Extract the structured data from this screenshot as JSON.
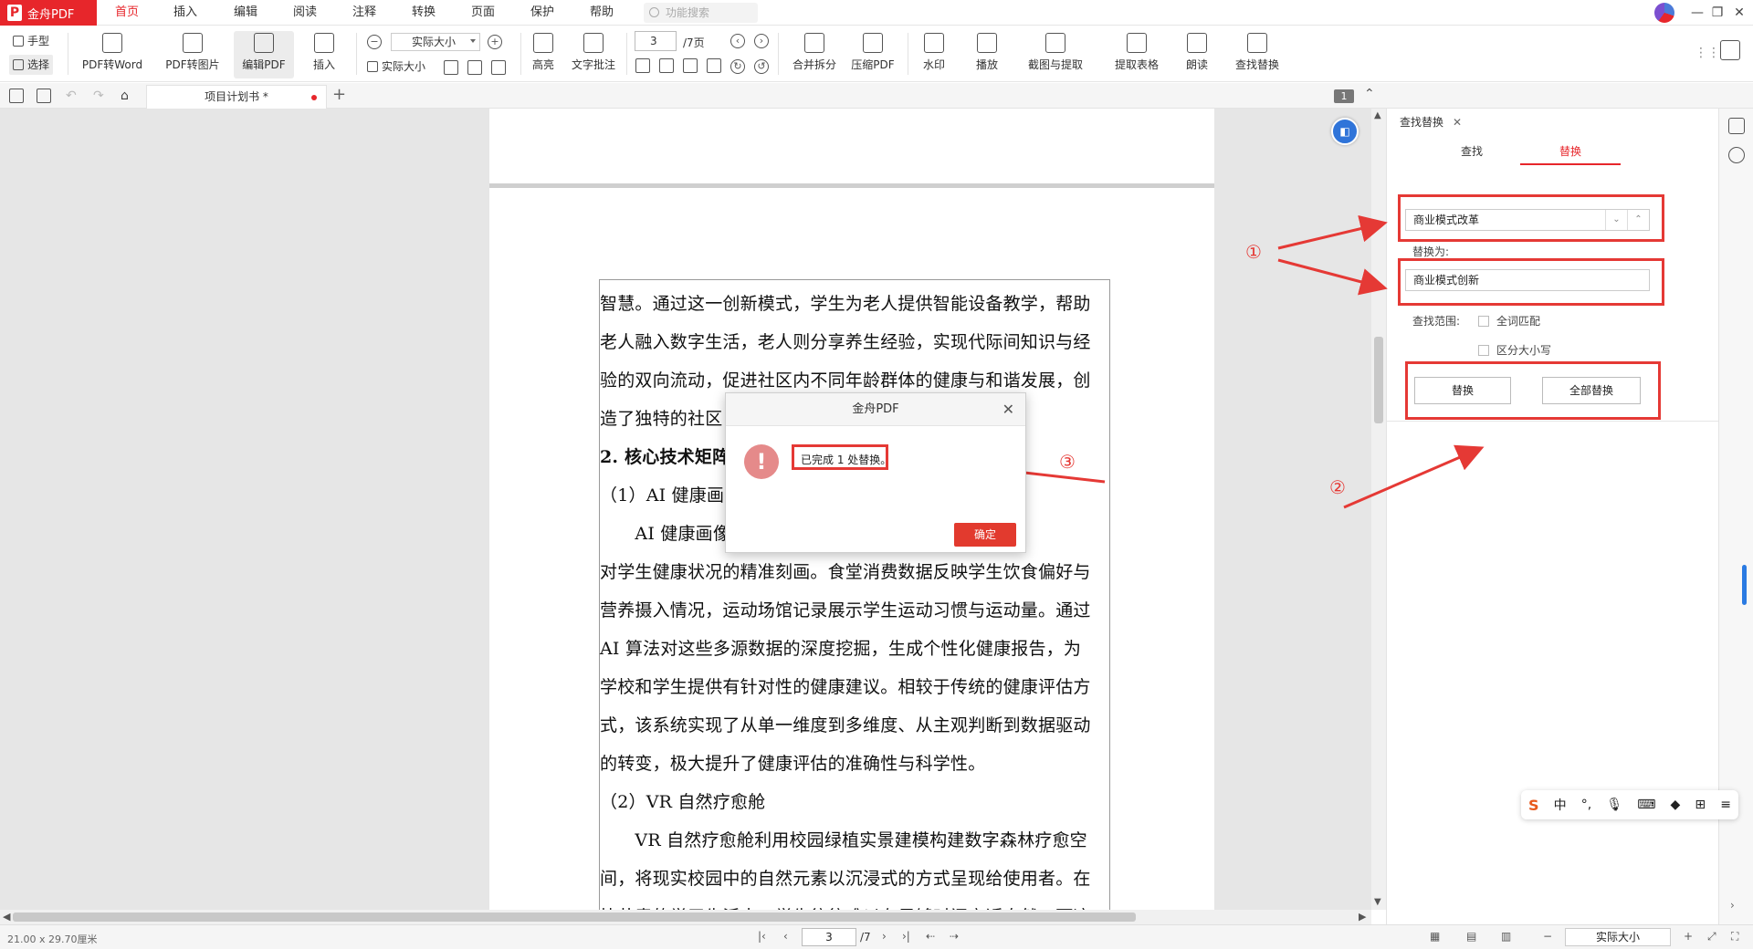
{
  "app": {
    "name": "金舟PDF",
    "menus": [
      "首页",
      "插入",
      "编辑",
      "阅读",
      "注释",
      "转换",
      "页面",
      "保护",
      "帮助"
    ],
    "active_menu": "首页",
    "search_placeholder": "功能搜索"
  },
  "ribbon": {
    "hand": "手型",
    "select": "选择",
    "pdf_to_word": "PDF转Word",
    "pdf_to_image": "PDF转图片",
    "edit_pdf": "编辑PDF",
    "insert": "插入",
    "zoom_value": "实际大小",
    "actual_size": "实际大小",
    "highlight": "高亮",
    "text_note": "文字批注",
    "page_current": "3",
    "page_total": "/7页",
    "merge_split": "合并拆分",
    "compress": "压缩PDF",
    "watermark": "水印",
    "play": "播放",
    "screenshot_extract": "截图与提取",
    "extract_table": "提取表格",
    "read_aloud": "朗读",
    "find_replace": "查找替换"
  },
  "tabs": {
    "doc_name": "项目计划书 *",
    "page_badge": "1"
  },
  "document": {
    "lines": [
      "智慧。通过这一创新模式，学生为老人提供智能设备教学，帮助",
      "老人融入数字生活，老人则分享养生经验，实现代际间知识与经",
      "验的双向流动，促进社区内不同年龄群体的健康与和谐发展，创",
      "造了独特的社区",
      "2. 核心技术矩阵",
      "（1）AI 健康画",
      "　　AI 健康画像                                                ，实现了",
      "对学生健康状况的精准刻画。食堂消费数据反映学生饮食偏好与",
      "营养摄入情况，运动场馆记录展示学生运动习惯与运动量。通过",
      "AI 算法对这些多源数据的深度挖掘，生成个性化健康报告，为",
      "学校和学生提供有针对性的健康建议。相较于传统的健康评估方",
      "式，该系统实现了从单一维度到多维度、从主观判断到数据驱动",
      "的转变，极大提升了健康评估的准确性与科学性。",
      "（2）VR 自然疗愈舱",
      "　　VR 自然疗愈舱利用校园绿植实景建模构建数字森林疗愈空",
      "间，将现实校园中的自然元素以沉浸式的方式呈现给使用者。在",
      "快节奏的学习生活中，学生往往难以有足够时间亲近自然，而这"
    ]
  },
  "panel": {
    "tab_title": "查找替换",
    "find_tab": "查找",
    "replace_tab": "替换",
    "find_value": "商业模式改革",
    "replace_label": "替换为:",
    "replace_value": "商业模式创新",
    "scope_label": "查找范围:",
    "whole_word": "全词匹配",
    "match_case": "区分大小写",
    "replace_button": "替换",
    "replace_all_button": "全部替换"
  },
  "annotations": {
    "one": "①",
    "two": "②",
    "three": "③"
  },
  "dialog": {
    "title": "金舟PDF",
    "message": "已完成 1 处替换。",
    "ok": "确定"
  },
  "status": {
    "dimensions": "21.00 x 29.70厘米",
    "page": "3",
    "total": "/7",
    "zoom": "实际大小"
  },
  "ime": {
    "lang": "中"
  },
  "colors": {
    "brand": "#e7262b",
    "annotation": "#e53935",
    "ok_button": "#e23a2e"
  }
}
